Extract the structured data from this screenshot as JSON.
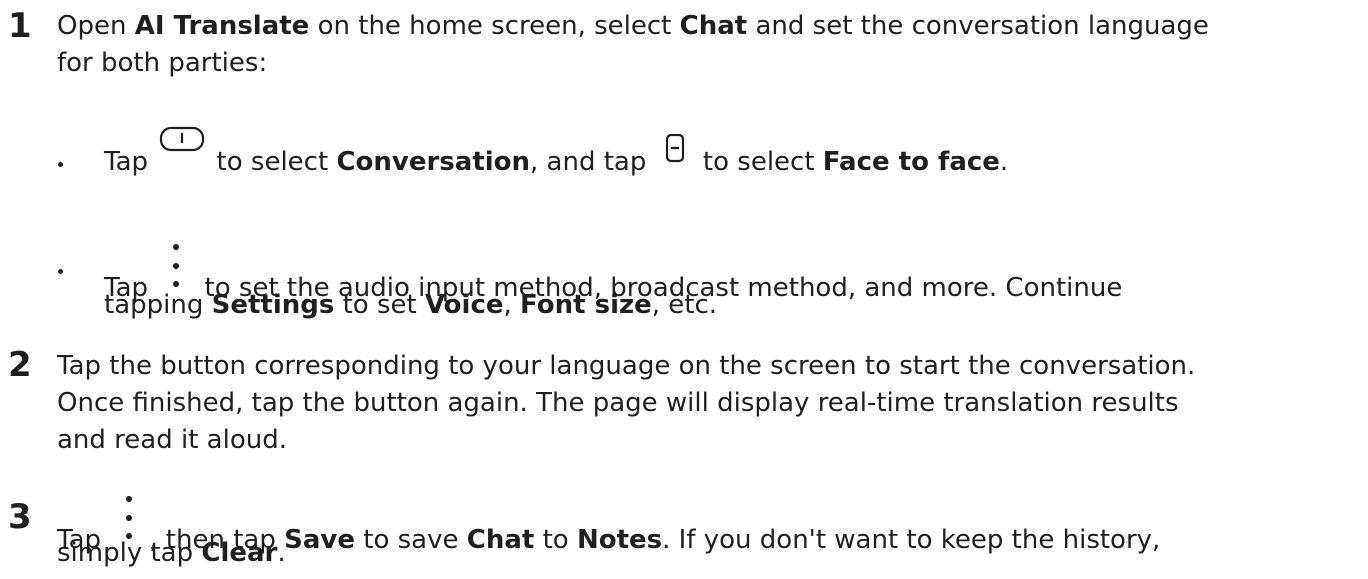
{
  "steps": [
    {
      "number": "1",
      "line1": {
        "t1": "Open ",
        "b1": "AI Translate",
        "t2": " on the home screen, select ",
        "b2": "Chat",
        "t3": " and set the conversation language"
      },
      "line2": "for both parties:",
      "bullets": [
        {
          "t1": "Tap ",
          "icon1": "conversation-mode-icon",
          "t2": " to select ",
          "b1": "Conversation",
          "t3": ", and tap ",
          "icon2": "face-to-face-mode-icon",
          "t4": " to select ",
          "b2": "Face to face",
          "t5": "."
        },
        {
          "t1": "Tap ",
          "icon1": "more-vertical-icon",
          "t2": " to set the audio input method, broadcast method, and more. Continue",
          "l2_t1": "tapping ",
          "l2_b1": "Settings",
          "l2_t2": " to set ",
          "l2_b2": "Voice",
          "l2_t3": ", ",
          "l2_b3": "Font size",
          "l2_t4": ", etc."
        }
      ]
    },
    {
      "number": "2",
      "lines": [
        "Tap the button corresponding to your language on the screen to start the conversation.",
        "Once finished, tap the button again. The page will display real-time translation results",
        "and read it aloud."
      ]
    },
    {
      "number": "3",
      "line1": {
        "t1": "Tap ",
        "icon1": "more-vertical-icon",
        "t2": ", then tap ",
        "b1": "Save",
        "t3": " to save ",
        "b2": "Chat",
        "t4": " to ",
        "b3": "Notes",
        "t5": ". If you don't want to keep the history,"
      },
      "line2": {
        "t1": "simply tap ",
        "b1": "Clear",
        "t2": "."
      }
    }
  ]
}
